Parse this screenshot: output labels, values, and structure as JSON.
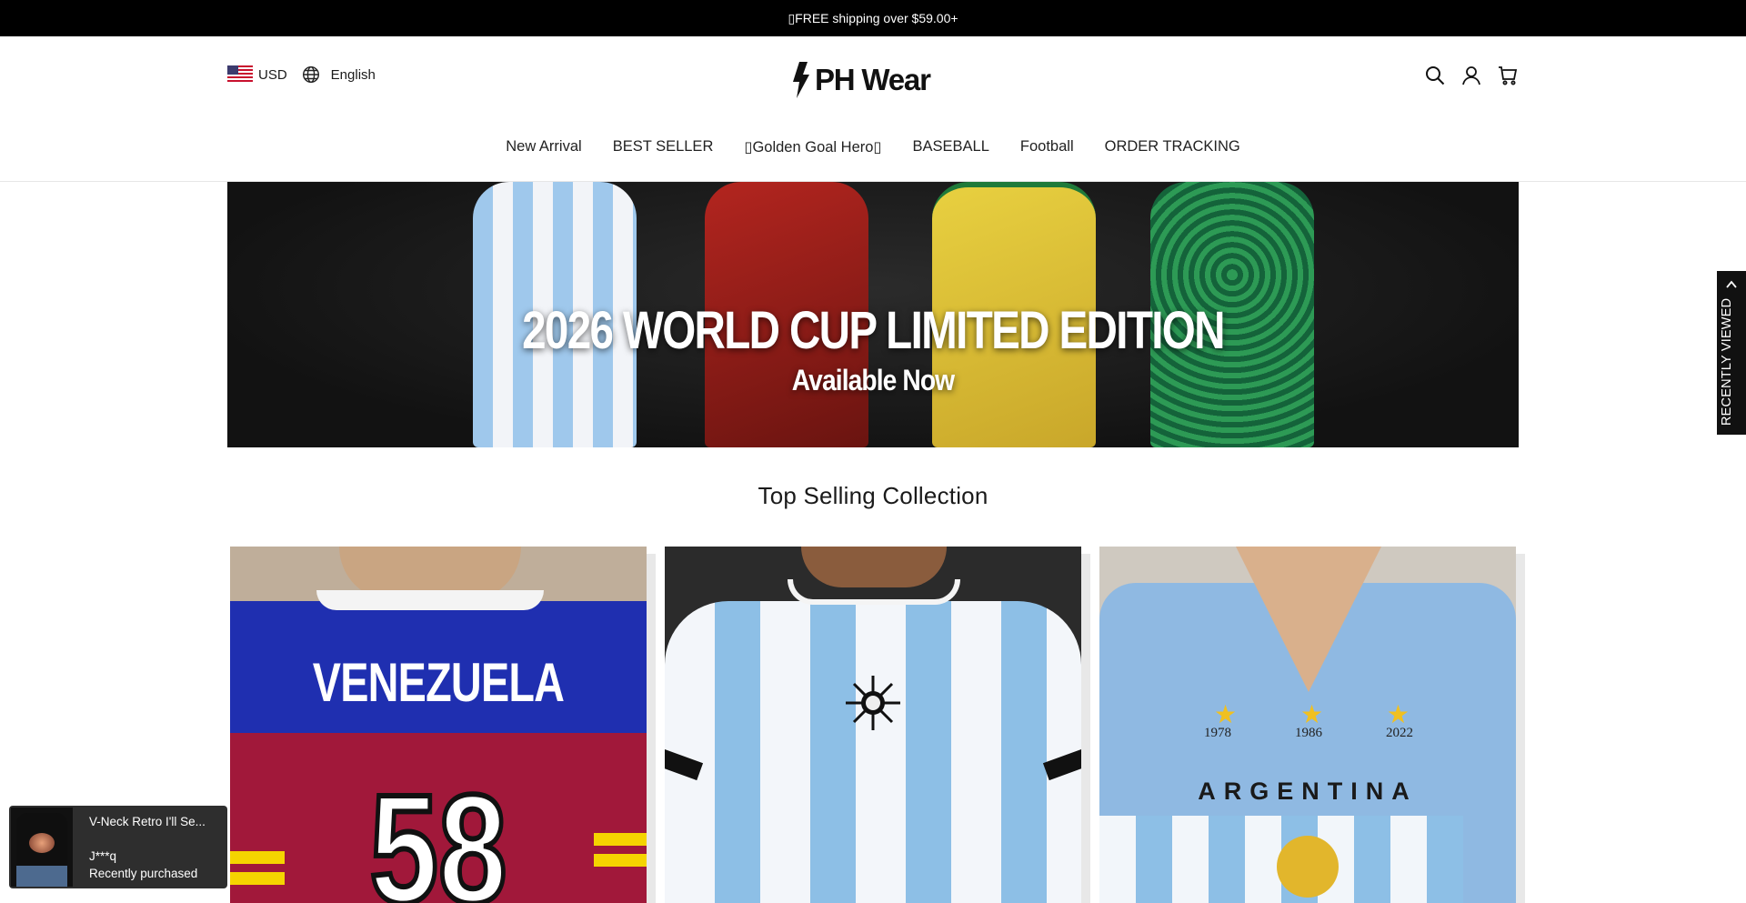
{
  "announcement": {
    "text": "▯FREE shipping over $59.00+"
  },
  "header": {
    "currency": "USD",
    "language": "English",
    "logo_text": "PH Wear",
    "icons": [
      "search-icon",
      "account-icon",
      "cart-icon"
    ]
  },
  "nav": {
    "items": [
      {
        "label": "New Arrival"
      },
      {
        "label": "BEST SELLER"
      },
      {
        "label": "▯Golden Goal Hero▯"
      },
      {
        "label": "BASEBALL"
      },
      {
        "label": "Football"
      },
      {
        "label": "ORDER TRACKING"
      }
    ]
  },
  "banner": {
    "title": "2026 WORLD CUP LIMITED EDITION",
    "subtitle": "Available Now"
  },
  "collection": {
    "title": "Top Selling Collection",
    "products": [
      {
        "jersey_name": "VENEZUELA",
        "jersey_number": "58"
      },
      {
        "jersey_name": ""
      },
      {
        "jersey_name": "ARGENTINA",
        "years": [
          "1978",
          "1986",
          "2022"
        ]
      }
    ]
  },
  "toast": {
    "product": "V-Neck Retro I'll Se...",
    "buyer": "J***q",
    "status": "Recently purchased"
  },
  "recently_viewed": {
    "label": "RECENTLY VIEWED"
  },
  "colors": {
    "announcement_bg": "#000000",
    "toast_bg": "#2e2e2e",
    "recent_bg": "#111111"
  }
}
